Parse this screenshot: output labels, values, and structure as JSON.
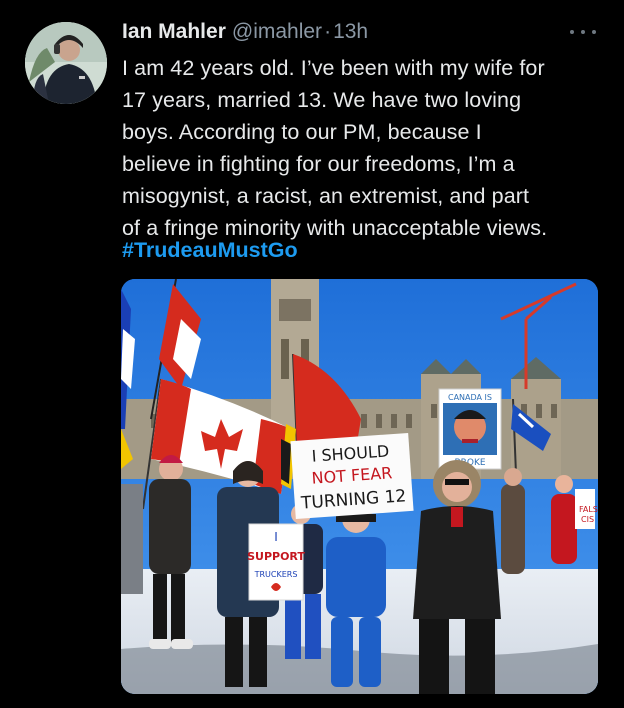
{
  "tweet": {
    "author_name": "Ian Mahler",
    "handle": "@imahler",
    "separator": "·",
    "timestamp": "13h",
    "body_lines": [
      "I am 42 years old. I’ve been with my wife for",
      "17 years, married 13. We have two loving",
      "boys. According to our PM, because I",
      "believe in fighting for our freedoms, I’m a",
      "misogynist, a racist, an extremist, and part",
      "of a fringe minority with unacceptable views."
    ],
    "hashtag": "#TrudeauMustGo"
  },
  "media": {
    "signs": {
      "main_line1": "I SHOULD",
      "main_line2": "NOT FEAR",
      "main_line3": "TURNING 12",
      "left_line1": "I",
      "left_line2": "SUPPORT",
      "left_line3": "TRUCKERS",
      "poster_top": "CANADA IS",
      "poster_bottom": "BROKE",
      "right_partial1": "FALS",
      "right_partial2": "CIS"
    }
  },
  "colors": {
    "background": "#000000",
    "text": "#e7e9ea",
    "muted": "#8b98a5",
    "link": "#1d9bf0",
    "sky": "#2a7de1",
    "flag_red": "#d52b1e"
  },
  "icons": {
    "more": "more-dots-icon"
  }
}
